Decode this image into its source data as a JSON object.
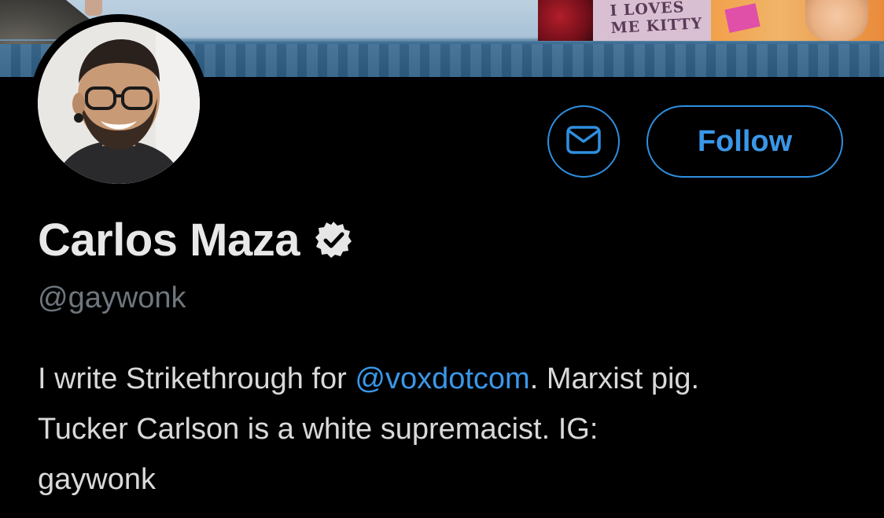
{
  "banner": {
    "shirt_text": "I LOVES\nME KITTY"
  },
  "profile": {
    "display_name": "Carlos Maza",
    "handle": "@gaywonk",
    "verified": true,
    "bio": {
      "part1": "I write Strikethrough for ",
      "mention": "@voxdotcom",
      "part2": ". Marxist pig.",
      "line2": "Tucker Carlson is a white supremacist. IG:",
      "line3": "gaywonk"
    }
  },
  "actions": {
    "follow_label": "Follow",
    "message_icon": "envelope-icon"
  },
  "colors": {
    "background": "#000000",
    "accent": "#3a97e8",
    "name": "#e8e8e8",
    "handle": "#6e767d",
    "bio_text": "#d9d9d9"
  }
}
